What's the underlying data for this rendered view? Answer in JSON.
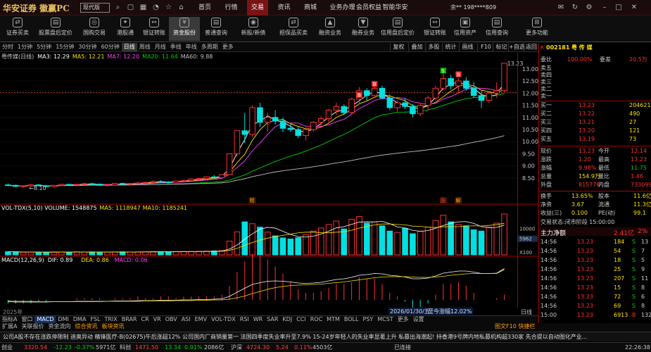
{
  "app": {
    "logo": "华安证券 徽赢PC",
    "mode": "现代版",
    "user": "余** 198****809"
  },
  "nav": [
    "首页",
    "行情",
    "交易",
    "资讯",
    "商城",
    "业务办理",
    "会员权益",
    "智能华安"
  ],
  "nav_active": 2,
  "toolbar": [
    "证券买卖",
    "股票盘后定价",
    "国购交易",
    "港股通",
    "银证转账",
    "资金股份",
    "普通查询",
    "新股/新债",
    "担保品买卖",
    "融资业务",
    "融券业务",
    "信用盘后定价",
    "银证转账",
    "信用资产",
    "信用查询",
    "更多功能"
  ],
  "toolbar_active": 5,
  "periods": [
    "分时",
    "1分钟",
    "5分钟",
    "15分钟",
    "30分钟",
    "60分钟",
    "日线",
    "周线",
    "月线",
    "季线",
    "年线",
    "多周期",
    "更多"
  ],
  "period_active": 6,
  "right_buttons": [
    "复权",
    "叠加",
    "多股",
    "统计",
    "画线",
    "F10",
    "标记",
    "+自选",
    "返回"
  ],
  "title": "粤传媒(日线)",
  "ma_line": [
    {
      "t": "MA3: 12.29",
      "c": "#ffffff"
    },
    {
      "t": "MA5: 12.21",
      "c": "#ffe000"
    },
    {
      "t": "MA7: 12.20",
      "c": "#ff40ff"
    },
    {
      "t": "MA20: 11.64",
      "c": "#00d000"
    },
    {
      "t": "MA60: 9.88",
      "c": "#c0c0c0"
    }
  ],
  "vol_line": [
    {
      "t": "VOL-TDX(5,10) VOLUME: 1548875",
      "c": "#ffffff"
    },
    {
      "t": "MA5: 1118947",
      "c": "#ffe000"
    },
    {
      "t": "MA10: 1185241",
      "c": "#ffe000"
    }
  ],
  "macd_line": [
    {
      "t": "MACD(12,26,9)",
      "c": "#ffffff"
    },
    {
      "t": "DIF: 0.89",
      "c": "#ffffff"
    },
    {
      "t": "DEA: 0.86",
      "c": "#ffe000"
    },
    {
      "t": "MACD: 0.06",
      "c": "#ff40ff"
    }
  ],
  "price_ticks": [
    "13.00",
    "12.50",
    "12.00",
    "11.50",
    "11.00",
    "10.50",
    "10.00",
    "9.50",
    "9.00",
    "8.50"
  ],
  "vol_ticks": [
    "10000",
    "5962",
    "X100"
  ],
  "max_label": "13.23",
  "min_label": "8.10",
  "date_label": "2026/01/30/五",
  "date_flag": "至今涨幅12.02%",
  "year_label": "2025年",
  "markers": [
    "S",
    "B",
    "B",
    "B"
  ],
  "event_labels": [
    "榜",
    "涨",
    "解"
  ],
  "chart_data": {
    "type": "candlestick",
    "candles": [
      [
        8.22,
        8.28,
        8.18,
        8.2
      ],
      [
        8.2,
        8.24,
        8.12,
        8.16
      ],
      [
        8.16,
        8.21,
        8.1,
        8.18
      ],
      [
        8.18,
        8.26,
        8.14,
        8.22
      ],
      [
        8.22,
        8.25,
        8.16,
        8.18
      ],
      [
        8.18,
        8.22,
        8.12,
        8.15
      ],
      [
        8.15,
        8.22,
        8.12,
        8.2
      ],
      [
        8.2,
        8.27,
        8.16,
        8.24
      ],
      [
        8.24,
        8.27,
        8.18,
        8.21
      ],
      [
        8.21,
        8.26,
        8.17,
        8.24
      ],
      [
        8.24,
        8.3,
        8.2,
        8.27
      ],
      [
        8.27,
        8.31,
        8.22,
        8.25
      ],
      [
        8.25,
        8.28,
        8.18,
        8.2
      ],
      [
        8.2,
        8.24,
        8.15,
        8.22
      ],
      [
        8.22,
        8.3,
        8.18,
        8.28
      ],
      [
        8.28,
        8.32,
        8.22,
        8.25
      ],
      [
        8.25,
        8.3,
        8.2,
        8.28
      ],
      [
        8.28,
        8.34,
        8.24,
        8.3
      ],
      [
        8.3,
        8.36,
        8.25,
        8.32
      ],
      [
        8.32,
        8.4,
        8.28,
        8.36
      ],
      [
        8.36,
        8.42,
        8.3,
        8.34
      ],
      [
        8.34,
        8.38,
        8.28,
        8.32
      ],
      [
        8.32,
        8.4,
        8.3,
        8.38
      ],
      [
        8.38,
        8.44,
        8.32,
        8.4
      ],
      [
        8.4,
        8.48,
        8.36,
        8.46
      ],
      [
        8.46,
        8.52,
        8.4,
        8.48
      ],
      [
        8.48,
        8.58,
        8.44,
        8.55
      ],
      [
        8.55,
        8.62,
        8.48,
        8.52
      ],
      [
        8.52,
        8.66,
        8.5,
        8.64
      ],
      [
        8.64,
        9.5,
        8.62,
        9.5
      ],
      [
        9.5,
        10.45,
        9.4,
        10.45
      ],
      [
        10.45,
        11.18,
        9.95,
        10.3
      ],
      [
        10.3,
        11.5,
        10.2,
        11.4
      ],
      [
        11.4,
        11.6,
        10.6,
        10.8
      ],
      [
        10.8,
        11.2,
        10.4,
        11.0
      ],
      [
        11.0,
        11.3,
        10.7,
        10.85
      ],
      [
        10.85,
        11.0,
        10.4,
        10.55
      ],
      [
        10.55,
        10.75,
        10.4,
        10.5
      ],
      [
        10.5,
        10.6,
        10.15,
        10.25
      ],
      [
        10.25,
        10.6,
        10.05,
        10.5
      ],
      [
        10.5,
        10.85,
        10.4,
        10.8
      ],
      [
        10.8,
        11.05,
        10.6,
        10.95
      ],
      [
        10.95,
        11.35,
        10.8,
        11.3
      ],
      [
        11.3,
        11.6,
        11.1,
        11.45
      ],
      [
        11.45,
        11.55,
        11.1,
        11.2
      ],
      [
        11.2,
        11.8,
        11.15,
        11.75
      ],
      [
        11.75,
        12.25,
        11.6,
        12.1
      ],
      [
        12.1,
        12.2,
        11.7,
        11.9
      ],
      [
        11.9,
        12.3,
        11.8,
        12.2
      ],
      [
        12.2,
        12.3,
        11.75,
        11.8
      ],
      [
        11.8,
        11.95,
        11.3,
        11.4
      ],
      [
        11.4,
        11.7,
        11.25,
        11.6
      ],
      [
        11.6,
        11.8,
        11.35,
        11.45
      ],
      [
        11.45,
        11.55,
        11.0,
        11.15
      ],
      [
        11.15,
        11.6,
        11.05,
        11.5
      ],
      [
        11.5,
        11.9,
        11.3,
        11.8
      ],
      [
        11.8,
        12.3,
        11.7,
        12.2
      ],
      [
        12.2,
        12.9,
        12.1,
        12.6
      ],
      [
        12.6,
        12.75,
        12.15,
        12.3
      ],
      [
        12.3,
        12.6,
        12.0,
        12.5
      ],
      [
        12.5,
        12.65,
        12.1,
        12.2
      ],
      [
        12.2,
        12.45,
        11.8,
        11.9
      ],
      [
        11.9,
        12.1,
        11.4,
        11.7
      ],
      [
        11.7,
        12.05,
        11.6,
        12.0
      ],
      [
        12.0,
        12.45,
        11.8,
        12.1
      ],
      [
        12.1,
        13.23,
        12.05,
        13.23
      ]
    ],
    "volumes": [
      120,
      110,
      100,
      105,
      95,
      100,
      110,
      105,
      100,
      115,
      108,
      112,
      100,
      105,
      110,
      115,
      108,
      112,
      118,
      125,
      120,
      115,
      122,
      128,
      130,
      135,
      140,
      150,
      160,
      520,
      870,
      1250,
      1180,
      1050,
      860,
      720,
      640,
      600,
      650,
      760,
      900,
      1020,
      1150,
      1280,
      980,
      1350,
      1450,
      1200,
      1250,
      1100,
      900,
      850,
      1000,
      800,
      900,
      1050,
      1300,
      1500,
      1250,
      1150,
      1100,
      950,
      900,
      1050,
      1200,
      1548
    ],
    "macd_dif": [
      -0.05,
      -0.06,
      -0.06,
      -0.06,
      -0.06,
      -0.06,
      -0.05,
      -0.05,
      -0.05,
      -0.04,
      -0.04,
      -0.04,
      -0.04,
      -0.04,
      -0.03,
      -0.03,
      -0.03,
      -0.02,
      -0.02,
      -0.02,
      -0.01,
      -0.01,
      -0.01,
      0.0,
      0.0,
      0.01,
      0.01,
      0.02,
      0.03,
      0.1,
      0.22,
      0.33,
      0.44,
      0.49,
      0.53,
      0.54,
      0.53,
      0.51,
      0.48,
      0.47,
      0.48,
      0.5,
      0.54,
      0.58,
      0.6,
      0.64,
      0.7,
      0.72,
      0.75,
      0.74,
      0.7,
      0.68,
      0.65,
      0.6,
      0.6,
      0.62,
      0.68,
      0.76,
      0.79,
      0.82,
      0.82,
      0.79,
      0.75,
      0.75,
      0.76,
      0.89
    ],
    "macd_dea": [
      -0.03,
      -0.04,
      -0.04,
      -0.04,
      -0.05,
      -0.05,
      -0.05,
      -0.05,
      -0.05,
      -0.05,
      -0.05,
      -0.05,
      -0.05,
      -0.04,
      -0.04,
      -0.04,
      -0.04,
      -0.04,
      -0.03,
      -0.03,
      -0.03,
      -0.03,
      -0.02,
      -0.02,
      -0.02,
      -0.01,
      -0.01,
      0.0,
      0.0,
      0.02,
      0.06,
      0.11,
      0.18,
      0.24,
      0.3,
      0.35,
      0.38,
      0.41,
      0.42,
      0.43,
      0.44,
      0.45,
      0.47,
      0.49,
      0.51,
      0.54,
      0.57,
      0.6,
      0.63,
      0.65,
      0.66,
      0.66,
      0.66,
      0.65,
      0.64,
      0.64,
      0.65,
      0.67,
      0.7,
      0.72,
      0.74,
      0.75,
      0.75,
      0.75,
      0.75,
      0.86
    ],
    "ylim": [
      7.6,
      13.4
    ]
  },
  "quote": {
    "code": "002181",
    "name": "粤 传 媒",
    "webi": "委比",
    "webi_v": "100.00%",
    "weicha": "委差",
    "weicha_v": "20.5万",
    "sell": [
      {
        "l": "卖五",
        "p": "",
        "v": ""
      },
      {
        "l": "卖四",
        "p": "",
        "v": ""
      },
      {
        "l": "卖三",
        "p": "",
        "v": ""
      },
      {
        "l": "卖二",
        "p": "",
        "v": ""
      },
      {
        "l": "卖一",
        "p": "",
        "v": ""
      }
    ],
    "buy": [
      {
        "l": "买一",
        "p": "13.23",
        "v": "204621"
      },
      {
        "l": "买二",
        "p": "13.22",
        "v": "490"
      },
      {
        "l": "买三",
        "p": "13.21",
        "v": "27"
      },
      {
        "l": "买四",
        "p": "13.20",
        "v": "121"
      },
      {
        "l": "买五",
        "p": "13.19",
        "v": "73"
      }
    ],
    "stats": [
      [
        "现价",
        "13.23",
        "今开",
        "12.14"
      ],
      [
        "涨跌",
        "1.20",
        "最高",
        "13.23"
      ],
      [
        "涨幅",
        "9.98%",
        "最低",
        "11.75"
      ],
      [
        "总量",
        "154.9万",
        "量比",
        "1.46"
      ],
      [
        "外盘",
        "815776",
        "内盘",
        "733099"
      ]
    ],
    "stats2": [
      [
        "换手",
        "13.65%",
        "股本",
        "11.6亿"
      ],
      [
        "净资",
        "3.67",
        "流通",
        "11.3亿"
      ],
      [
        "收益(三)",
        "0.100",
        "PE(动)",
        "99.1"
      ]
    ],
    "status": "交易状态:闭市阶段 15:00:00",
    "netflow_label": "主力净额",
    "netflow_value": "2.41亿",
    "netflow_pct": "2%",
    "ticks": [
      [
        "14:56",
        "13.23",
        "184",
        "S",
        "13"
      ],
      [
        "14:56",
        "13.23",
        "54",
        "S",
        "7"
      ],
      [
        "14:56",
        "13.23",
        "18",
        "S",
        "5"
      ],
      [
        "14:56",
        "13.23",
        "25",
        "S",
        "9"
      ],
      [
        "14:56",
        "13.23",
        "207",
        "S",
        "11"
      ],
      [
        "14:56",
        "13.23",
        "15",
        "S",
        "8"
      ],
      [
        "14:56",
        "13.23",
        "72",
        "S",
        "6"
      ],
      [
        "14:56",
        "13.23",
        "69",
        "S",
        "8"
      ],
      [
        "15:00",
        "13.23",
        "6913",
        "B",
        "132"
      ]
    ]
  },
  "bottom_tabs": [
    "指标A",
    "窗口",
    "MACD",
    "DMI",
    "DMA",
    "FSL",
    "TRIX",
    "BRAR",
    "CR",
    "VR",
    "OBV",
    "ASI",
    "EMV",
    "VOL-TDX",
    "RSI",
    "WR",
    "SAR",
    "KDJ",
    "CCI",
    "ROC",
    "MTM",
    "BOLL",
    "PSY",
    "MCST",
    "更多",
    "设置"
  ],
  "bottom_active": 2,
  "row2_tabs": [
    "扩展A",
    "关联报价",
    "资金流向",
    "综合资讯",
    "板块资讯"
  ],
  "row2_right": "图文F10 快捷栏",
  "news": "公司A股不存在涨跌停限制    迪奥异动    精锋医疗-B(02675)午后涨超12% 公司国内厂商销量第一    法国四季度失业率升至7.9% 15-24岁年轻人的失业率显著上升    私募出海潮起! 持香港9号牌内地私募机构超330家    先合提以自动图化产业...",
  "status_items": [
    {
      "t": "创业",
      "c": "#ccc"
    },
    {
      "t": "3320.54",
      "c": "#ff4040"
    },
    {
      "t": "-12.23",
      "c": "#00d000"
    },
    {
      "t": "-0.37%",
      "c": "#00d000"
    },
    {
      "t": "5971亿",
      "c": "#ccc"
    },
    {
      "t": "科创",
      "c": "#ccc"
    },
    {
      "t": "1471.50",
      "c": "#ff4040"
    },
    {
      "t": "13.34",
      "c": "#00d000"
    },
    {
      "t": "0.91%",
      "c": "#00d000"
    },
    {
      "t": "2086亿",
      "c": "#ccc"
    },
    {
      "t": "沪深",
      "c": "#ccc"
    },
    {
      "t": "4724.30",
      "c": "#ff4040"
    },
    {
      "t": "5.24",
      "c": "#ff4040"
    },
    {
      "t": "0.11%",
      "c": "#ff4040"
    },
    {
      "t": "4503亿",
      "c": "#ccc"
    },
    {
      "t": "已连接",
      "c": "#ccc"
    },
    {
      "t": "22:26:38",
      "c": "#ccc"
    }
  ],
  "colors": {
    "up": "#ff3030",
    "down": "#00e0e0",
    "accent": "#7a1414"
  }
}
